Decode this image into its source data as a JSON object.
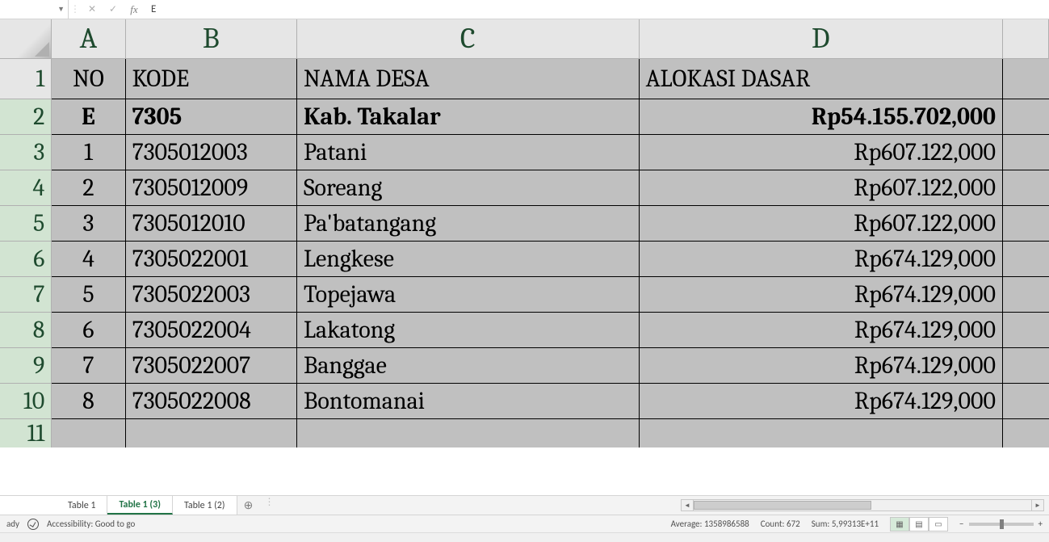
{
  "formula_bar": {
    "value": "E",
    "fx": "fx"
  },
  "columns": [
    "A",
    "B",
    "C",
    "D"
  ],
  "rows_header": [
    "1",
    "2",
    "3",
    "4",
    "5",
    "6",
    "7",
    "8",
    "9",
    "10",
    "11"
  ],
  "header_row": {
    "no": "NO",
    "kode": "KODE",
    "nama": "NAMA DESA",
    "alokasi": "ALOKASI DASAR"
  },
  "summary_row": {
    "no": "E",
    "kode": "7305",
    "nama": "Kab.  Takalar",
    "alokasi": "Rp54.155.702,000"
  },
  "data": [
    {
      "no": "1",
      "kode": "7305012003",
      "nama": "Patani",
      "alokasi": "Rp607.122,000"
    },
    {
      "no": "2",
      "kode": "7305012009",
      "nama": "Soreang",
      "alokasi": "Rp607.122,000"
    },
    {
      "no": "3",
      "kode": "7305012010",
      "nama": "Pa'batangang",
      "alokasi": "Rp607.122,000"
    },
    {
      "no": "4",
      "kode": "7305022001",
      "nama": "Lengkese",
      "alokasi": "Rp674.129,000"
    },
    {
      "no": "5",
      "kode": "7305022003",
      "nama": "Topejawa",
      "alokasi": "Rp674.129,000"
    },
    {
      "no": "6",
      "kode": "7305022004",
      "nama": "Lakatong",
      "alokasi": "Rp674.129,000"
    },
    {
      "no": "7",
      "kode": "7305022007",
      "nama": "Banggae",
      "alokasi": "Rp674.129,000"
    },
    {
      "no": "8",
      "kode": "7305022008",
      "nama": "Bontomanai",
      "alokasi": "Rp674.129,000"
    }
  ],
  "tabs": [
    {
      "label": "Table 1",
      "active": false
    },
    {
      "label": "Table 1 (3)",
      "active": true
    },
    {
      "label": "Table 1 (2)",
      "active": false
    }
  ],
  "status": {
    "ready": "ady",
    "accessibility": "Accessibility: Good to go",
    "average_label": "Average:",
    "average_value": "1358986588",
    "count_label": "Count:",
    "count_value": "672",
    "sum_label": "Sum:",
    "sum_value": "5,99313E+11"
  },
  "chart_data": {
    "type": "table",
    "title": "ALOKASI DASAR",
    "columns": [
      "NO",
      "KODE",
      "NAMA DESA",
      "ALOKASI DASAR"
    ],
    "summary": {
      "NO": "E",
      "KODE": "7305",
      "NAMA DESA": "Kab. Takalar",
      "ALOKASI DASAR": 54155702000
    },
    "rows": [
      {
        "NO": 1,
        "KODE": "7305012003",
        "NAMA DESA": "Patani",
        "ALOKASI DASAR": 607122000
      },
      {
        "NO": 2,
        "KODE": "7305012009",
        "NAMA DESA": "Soreang",
        "ALOKASI DASAR": 607122000
      },
      {
        "NO": 3,
        "KODE": "7305012010",
        "NAMA DESA": "Pa'batangang",
        "ALOKASI DASAR": 607122000
      },
      {
        "NO": 4,
        "KODE": "7305022001",
        "NAMA DESA": "Lengkese",
        "ALOKASI DASAR": 674129000
      },
      {
        "NO": 5,
        "KODE": "7305022003",
        "NAMA DESA": "Topejawa",
        "ALOKASI DASAR": 674129000
      },
      {
        "NO": 6,
        "KODE": "7305022004",
        "NAMA DESA": "Lakatong",
        "ALOKASI DASAR": 674129000
      },
      {
        "NO": 7,
        "KODE": "7305022007",
        "NAMA DESA": "Banggae",
        "ALOKASI DASAR": 674129000
      },
      {
        "NO": 8,
        "KODE": "7305022008",
        "NAMA DESA": "Bontomanai",
        "ALOKASI DASAR": 674129000
      }
    ]
  }
}
